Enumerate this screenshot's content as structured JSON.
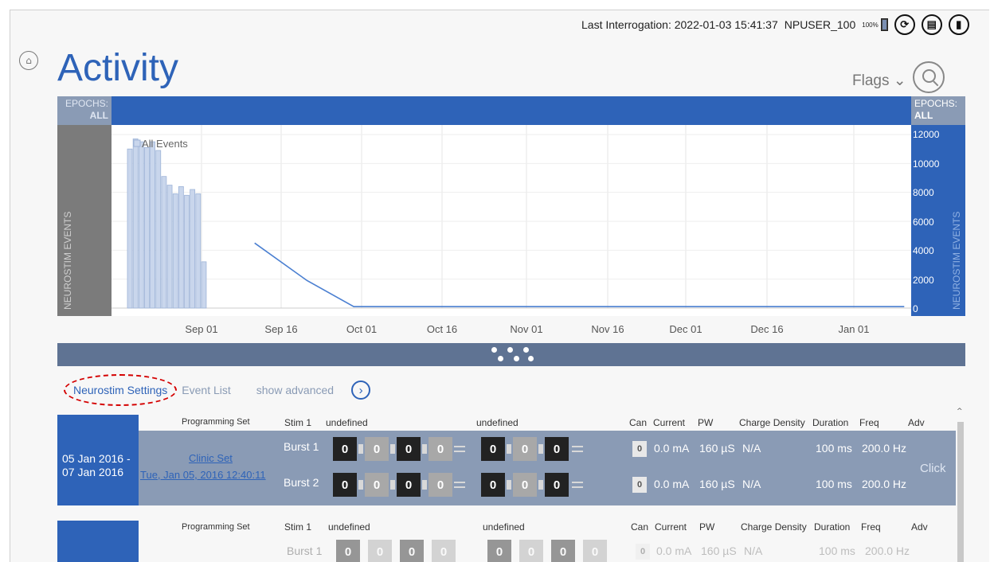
{
  "header": {
    "last_interrogation": "Last Interrogation: 2022-01-03 15:41:37",
    "user": "NPUSER_100",
    "battery": "100%",
    "icons": [
      "refresh-icon",
      "briefcase-icon",
      "signal-icon"
    ]
  },
  "page": {
    "title": "Activity",
    "flags_label": "Flags",
    "home_icon": "home-icon",
    "search_icon": "search-icon"
  },
  "epochs": {
    "label": "EPOCHS:",
    "value": "ALL"
  },
  "chart_data": {
    "type": "bar",
    "legend": "All Events",
    "ylabel": "NEUROSTIM EVENTS",
    "yticks": [
      "12000",
      "10000",
      "8000",
      "6000",
      "4000",
      "2000",
      "0"
    ],
    "ylim": [
      0,
      12000
    ],
    "xticks": [
      "Sep 01",
      "Sep 16",
      "Oct 01",
      "Oct 16",
      "Nov 01",
      "Nov 16",
      "Dec 01",
      "Dec 16",
      "Jan 01"
    ],
    "bars": [
      11000,
      11700,
      11500,
      11100,
      11500,
      10900,
      9100,
      8500,
      7900,
      8400,
      7800,
      8200,
      7900,
      3200
    ],
    "line": [
      {
        "x": "Sep 11",
        "y": 4500
      },
      {
        "x": "Sep 21",
        "y": 1900
      },
      {
        "x": "Sep 30",
        "y": 100
      },
      {
        "x": "Jan 10",
        "y": 100
      }
    ],
    "colors": {
      "bars": "#c9d6ec",
      "bar_border": "#9eb4d8",
      "line": "#4a7fd1"
    }
  },
  "tabs": {
    "neurostim": "Neurostim Settings",
    "events": "Event List",
    "advanced": "show advanced",
    "advanced_icon": "chevron-right-icon"
  },
  "columns": {
    "programming_set": "Programming Set",
    "stim": "Stim 1",
    "undef1": "undefined",
    "undef2": "undefined",
    "can": "Can",
    "current": "Current",
    "pw": "PW",
    "charge": "Charge Density",
    "duration": "Duration",
    "freq": "Freq",
    "adv": "Adv"
  },
  "row1": {
    "date_from": "05 Jan 2016 -",
    "date_to": "07 Jan 2016",
    "set_name": "Clinic Set",
    "set_date": "Tue, Jan 05, 2016 12:40:11",
    "click": "Click",
    "bursts": [
      {
        "label": "Burst 1",
        "cells": [
          "0",
          "0",
          "0",
          "0",
          "0",
          "0",
          "0"
        ],
        "can": "0",
        "current": "0.0 mA",
        "pw": "160 µS",
        "charge": "N/A",
        "duration": "100 ms",
        "freq": "200.0 Hz"
      },
      {
        "label": "Burst 2",
        "cells": [
          "0",
          "0",
          "0",
          "0",
          "0",
          "0",
          "0"
        ],
        "can": "0",
        "current": "0.0 mA",
        "pw": "160 µS",
        "charge": "N/A",
        "duration": "100 ms",
        "freq": "200.0 Hz"
      }
    ]
  },
  "row2": {
    "burst_label": "Burst 1",
    "cells": [
      "0",
      "0",
      "0",
      "0",
      "0",
      "0",
      "0",
      "0"
    ],
    "can": "0",
    "current": "0.0 mA",
    "pw": "160 µS",
    "charge": "N/A",
    "duration": "100 ms",
    "freq": "200.0 Hz"
  }
}
